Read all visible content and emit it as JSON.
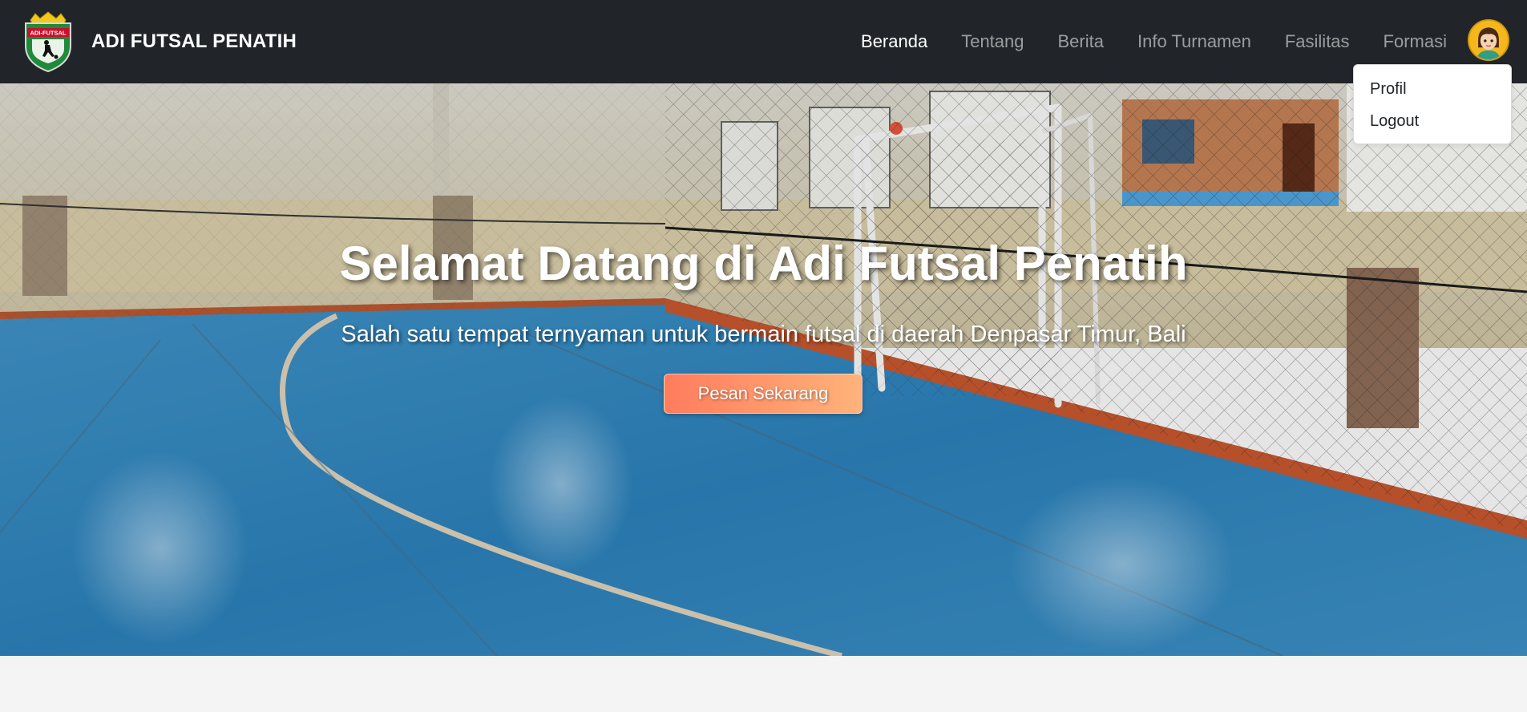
{
  "brand": {
    "name": "ADI FUTSAL PENATIH",
    "logo_text": "ADI-FUTSAL",
    "logo_colors": {
      "shield": "#1e8a3a",
      "banner": "#c8102e",
      "crown": "#f2c81f"
    }
  },
  "nav": {
    "items": [
      {
        "label": "Beranda",
        "active": true
      },
      {
        "label": "Tentang",
        "active": false
      },
      {
        "label": "Berita",
        "active": false
      },
      {
        "label": "Info Turnamen",
        "active": false
      },
      {
        "label": "Fasilitas",
        "active": false
      },
      {
        "label": "Formasi",
        "active": false
      }
    ],
    "avatar_icon": "user-avatar-icon"
  },
  "dropdown": {
    "items": [
      {
        "label": "Profil"
      },
      {
        "label": "Logout"
      }
    ]
  },
  "hero": {
    "title": "Selamat Datang di Adi Futsal Penatih",
    "subtitle": "Salah satu tempat ternyaman untuk bermain futsal di daerah Denpasar Timur, Bali",
    "button_label": "Pesan Sekarang",
    "background": "indoor-futsal-court-photo"
  },
  "colors": {
    "navbar": "#212529",
    "nav_active": "#ffffff",
    "nav_inactive": "#9a9da0",
    "button_start": "#ff7c5c",
    "button_end": "#ffb37a",
    "court": "#2c7fb6",
    "page_bg": "#f4f4f4"
  }
}
